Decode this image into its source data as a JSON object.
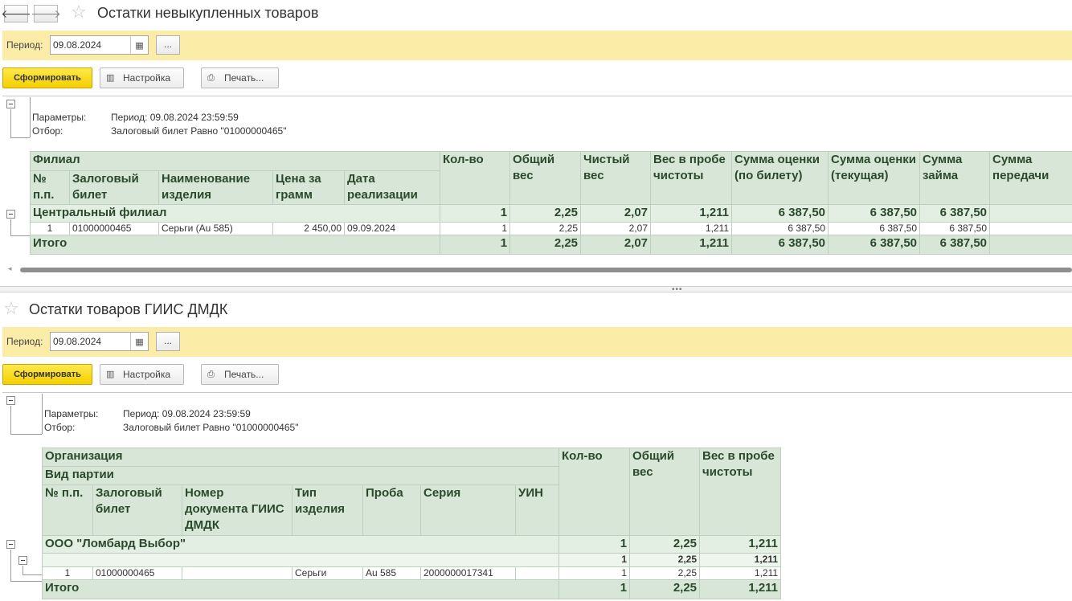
{
  "window": {
    "back_icon": "arrow-left-icon",
    "forward_icon": "arrow-right-icon",
    "title": "Остатки невыкупленных товаров"
  },
  "report1": {
    "period_label": "Период:",
    "period_value": "09.08.2024",
    "dots_label": "...",
    "generate_label": "Сформировать",
    "settings_label": "Настройка",
    "print_label": "Печать...",
    "params_label": "Параметры:",
    "params_value": "Период: 09.08.2024 23:59:59",
    "filter_label": "Отбор:",
    "filter_value": "Залоговый билет Равно \"01000000465\"",
    "headers": {
      "branch": "Филиал",
      "num": "№ п.п.",
      "ticket": "Залоговый билет",
      "name": "Наименование изделия",
      "price": "Цена за грамм",
      "date": "Дата реализации",
      "qty": "Кол-во",
      "gross": "Общий вес",
      "net": "Чистый вес",
      "fine": "Вес в пробе чистоты",
      "eval_ticket": "Сумма оценки (по билету)",
      "eval_current": "Сумма оценки (текущая)",
      "loan": "Сумма займа",
      "transfer": "Сумма передачи"
    },
    "group": {
      "name": "Центральный филиал",
      "qty": "1",
      "gross": "2,25",
      "net": "2,07",
      "fine": "1,211",
      "eval_ticket": "6 387,50",
      "eval_current": "6 387,50",
      "loan": "6 387,50",
      "transfer": ""
    },
    "row": {
      "num": "1",
      "ticket": "01000000465",
      "name": "Серьги (Au 585)",
      "price": "2 450,00",
      "date": "09.09.2024",
      "qty": "1",
      "gross": "2,25",
      "net": "2,07",
      "fine": "1,211",
      "eval_ticket": "6 387,50",
      "eval_current": "6 387,50",
      "loan": "6 387,50",
      "transfer": ""
    },
    "total": {
      "label": "Итого",
      "qty": "1",
      "gross": "2,25",
      "net": "2,07",
      "fine": "1,211",
      "eval_ticket": "6 387,50",
      "eval_current": "6 387,50",
      "loan": "6 387,50",
      "transfer": ""
    }
  },
  "report2": {
    "title": "Остатки товаров ГИИС ДМДК",
    "period_label": "Период:",
    "period_value": "09.08.2024",
    "dots_label": "...",
    "generate_label": "Сформировать",
    "settings_label": "Настройка",
    "print_label": "Печать...",
    "params_label": "Параметры:",
    "params_value": "Период: 09.08.2024 23:59:59",
    "filter_label": "Отбор:",
    "filter_value": "Залоговый билет Равно \"01000000465\"",
    "headers": {
      "org": "Организация",
      "batch": "Вид партии",
      "num": "№ п.п.",
      "ticket": "Залоговый билет",
      "doc": "Номер документа ГИИС ДМДК",
      "type": "Тип изделия",
      "probe": "Проба",
      "series": "Серия",
      "uin": "УИН",
      "qty": "Кол-во",
      "gross": "Общий вес",
      "fine": "Вес в пробе чистоты"
    },
    "group": {
      "name": "ООО \"Ломбард Выбор\"",
      "qty": "1",
      "gross": "2,25",
      "fine": "1,211"
    },
    "subgroup": {
      "name": "",
      "qty": "1",
      "gross": "2,25",
      "fine": "1,211"
    },
    "row": {
      "num": "1",
      "ticket": "01000000465",
      "doc": "",
      "type": "Серьги",
      "probe": "Au 585",
      "series": "2000000017341",
      "uin": "",
      "qty": "1",
      "gross": "2,25",
      "fine": "1,211"
    },
    "total": {
      "label": "Итого",
      "qty": "1",
      "gross": "2,25",
      "fine": "1,211"
    }
  }
}
